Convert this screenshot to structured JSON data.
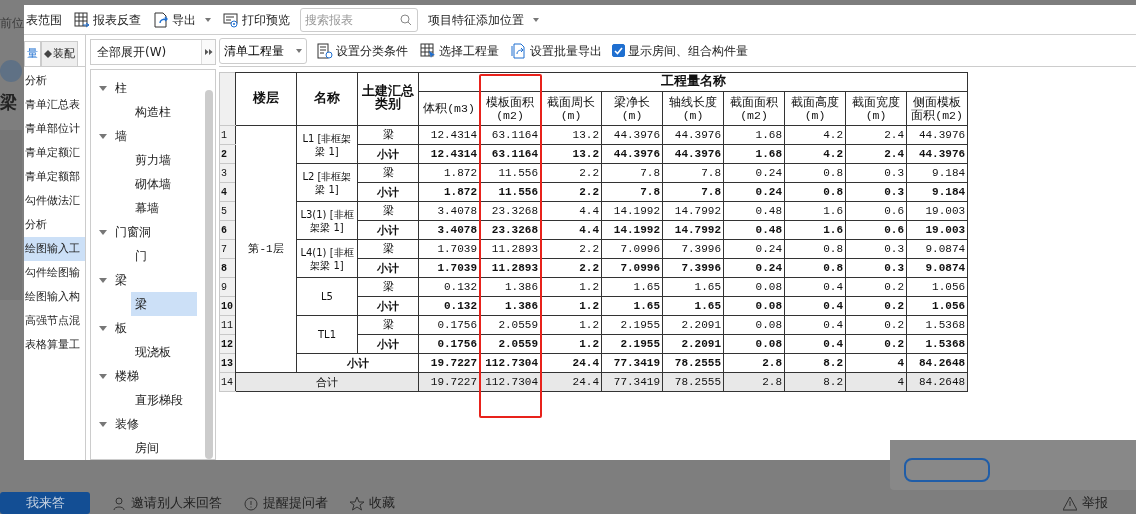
{
  "background_page": {
    "breadcrumb": "前位",
    "heading": "梁",
    "actions": [
      {
        "kind": "primary",
        "label": "我来答"
      },
      {
        "kind": "invite",
        "label": "邀请别人来回答"
      },
      {
        "kind": "remind",
        "label": "提醒提问者"
      },
      {
        "kind": "favorite",
        "label": "收藏"
      },
      {
        "kind": "report",
        "label": "举报"
      }
    ]
  },
  "toolbar": [
    {
      "kind": "text",
      "label": "表范围"
    },
    {
      "kind": "button",
      "label": "报表反查"
    },
    {
      "kind": "menu_button",
      "label": "导出"
    },
    {
      "kind": "button",
      "label": "打印预览"
    },
    {
      "kind": "search",
      "placeholder": "搜索报表"
    },
    {
      "kind": "dropdown",
      "label": "项目特征添加位置"
    }
  ],
  "left_tabs": [
    {
      "label": "量",
      "selected": true
    },
    {
      "label": "装配",
      "selected": false
    }
  ],
  "report_list": [
    {
      "label": "分析",
      "selected": false
    },
    {
      "label": "青单汇总表",
      "selected": false
    },
    {
      "label": "青单部位计",
      "selected": false
    },
    {
      "label": "青单定额汇",
      "selected": false
    },
    {
      "label": "青单定额部",
      "selected": false
    },
    {
      "label": "勾件做法汇",
      "selected": false
    },
    {
      "label": "分析",
      "selected": false
    },
    {
      "label": "绘图输入工",
      "selected": true
    },
    {
      "label": "勾件绘图输",
      "selected": false
    },
    {
      "label": "绘图输入构",
      "selected": false
    },
    {
      "label": "高强节点混",
      "selected": false
    },
    {
      "label": "表格算量工",
      "selected": false
    }
  ],
  "tree_filter": {
    "value": "全部展开(W)"
  },
  "tree": [
    {
      "label": "柱",
      "expanded": true,
      "children": [
        {
          "label": "构造柱",
          "selected": false
        }
      ]
    },
    {
      "label": "墙",
      "expanded": true,
      "children": [
        {
          "label": "剪力墙",
          "selected": false
        },
        {
          "label": "砌体墙",
          "selected": false
        },
        {
          "label": "幕墙",
          "selected": false
        }
      ]
    },
    {
      "label": "门窗洞",
      "expanded": true,
      "children": [
        {
          "label": "门",
          "selected": false
        }
      ]
    },
    {
      "label": "梁",
      "expanded": true,
      "children": [
        {
          "label": "梁",
          "selected": true
        }
      ]
    },
    {
      "label": "板",
      "expanded": true,
      "children": [
        {
          "label": "现浇板",
          "selected": false
        }
      ]
    },
    {
      "label": "楼梯",
      "expanded": true,
      "children": [
        {
          "label": "直形梯段",
          "selected": false
        }
      ]
    },
    {
      "label": "装修",
      "expanded": true,
      "children": [
        {
          "label": "房间",
          "selected": false
        }
      ]
    }
  ],
  "toolbar2": [
    {
      "kind": "dropdown",
      "label": "清单工程量"
    },
    {
      "kind": "button",
      "label": "设置分类条件"
    },
    {
      "kind": "button",
      "label": "选择工程量"
    },
    {
      "kind": "button",
      "label": "设置批量导出"
    },
    {
      "kind": "checkbox",
      "label": "显示房间、组合构件量",
      "checked": true
    }
  ],
  "table": {
    "group_header": "工程量名称",
    "columns": [
      {
        "label": "楼层",
        "highlighted": false
      },
      {
        "label": "名称",
        "highlighted": false
      },
      {
        "label": "土建汇总类别",
        "highlighted": false
      },
      {
        "label": "体积(m3)",
        "highlighted": false
      },
      {
        "label": "模板面积(m2)",
        "highlighted": true
      },
      {
        "label": "截面周长(m)",
        "highlighted": false
      },
      {
        "label": "梁净长(m)",
        "highlighted": false
      },
      {
        "label": "轴线长度(m)",
        "highlighted": false
      },
      {
        "label": "截面面积(m2)",
        "highlighted": false
      },
      {
        "label": "截面高度(m)",
        "highlighted": false
      },
      {
        "label": "截面宽度(m)",
        "highlighted": false
      },
      {
        "label": "侧面模板面积(m2)",
        "highlighted": false
      }
    ],
    "floors": [
      {
        "floor": "第-1层",
        "members": [
          {
            "name": "L1 [非框架梁 1]",
            "rows": [
              {
                "num": "1",
                "kind": "item",
                "category": "梁",
                "values": [
                  "12.4314",
                  "63.1164",
                  "13.2",
                  "44.3976",
                  "44.3976",
                  "1.68",
                  "4.2",
                  "2.4",
                  "44.3976"
                ]
              },
              {
                "num": "2",
                "kind": "subtotal",
                "category": "小计",
                "values": [
                  "12.4314",
                  "63.1164",
                  "13.2",
                  "44.3976",
                  "44.3976",
                  "1.68",
                  "4.2",
                  "2.4",
                  "44.3976"
                ]
              }
            ]
          },
          {
            "name": "L2 [非框架梁 1]",
            "rows": [
              {
                "num": "3",
                "kind": "item",
                "category": "梁",
                "values": [
                  "1.872",
                  "11.556",
                  "2.2",
                  "7.8",
                  "7.8",
                  "0.24",
                  "0.8",
                  "0.3",
                  "9.184"
                ]
              },
              {
                "num": "4",
                "kind": "subtotal",
                "category": "小计",
                "values": [
                  "1.872",
                  "11.556",
                  "2.2",
                  "7.8",
                  "7.8",
                  "0.24",
                  "0.8",
                  "0.3",
                  "9.184"
                ]
              }
            ]
          },
          {
            "name": "L3(1) [非框架梁 1]",
            "rows": [
              {
                "num": "5",
                "kind": "item",
                "category": "梁",
                "values": [
                  "3.4078",
                  "23.3268",
                  "4.4",
                  "14.1992",
                  "14.7992",
                  "0.48",
                  "1.6",
                  "0.6",
                  "19.003"
                ]
              },
              {
                "num": "6",
                "kind": "subtotal",
                "category": "小计",
                "values": [
                  "3.4078",
                  "23.3268",
                  "4.4",
                  "14.1992",
                  "14.7992",
                  "0.48",
                  "1.6",
                  "0.6",
                  "19.003"
                ]
              }
            ]
          },
          {
            "name": "L4(1) [非框架梁 1]",
            "rows": [
              {
                "num": "7",
                "kind": "item",
                "category": "梁",
                "values": [
                  "1.7039",
                  "11.2893",
                  "2.2",
                  "7.0996",
                  "7.3996",
                  "0.24",
                  "0.8",
                  "0.3",
                  "9.0874"
                ]
              },
              {
                "num": "8",
                "kind": "subtotal",
                "category": "小计",
                "values": [
                  "1.7039",
                  "11.2893",
                  "2.2",
                  "7.0996",
                  "7.3996",
                  "0.24",
                  "0.8",
                  "0.3",
                  "9.0874"
                ]
              }
            ]
          },
          {
            "name": "L5",
            "rows": [
              {
                "num": "9",
                "kind": "item",
                "category": "梁",
                "values": [
                  "0.132",
                  "1.386",
                  "1.2",
                  "1.65",
                  "1.65",
                  "0.08",
                  "0.4",
                  "0.2",
                  "1.056"
                ]
              },
              {
                "num": "10",
                "kind": "subtotal",
                "category": "小计",
                "values": [
                  "0.132",
                  "1.386",
                  "1.2",
                  "1.65",
                  "1.65",
                  "0.08",
                  "0.4",
                  "0.2",
                  "1.056"
                ]
              }
            ]
          },
          {
            "name": "TL1",
            "rows": [
              {
                "num": "11",
                "kind": "item",
                "category": "梁",
                "values": [
                  "0.1756",
                  "2.0559",
                  "1.2",
                  "2.1955",
                  "2.2091",
                  "0.08",
                  "0.4",
                  "0.2",
                  "1.5368"
                ]
              },
              {
                "num": "12",
                "kind": "subtotal",
                "category": "小计",
                "values": [
                  "0.1756",
                  "2.0559",
                  "1.2",
                  "2.1955",
                  "2.2091",
                  "0.08",
                  "0.4",
                  "0.2",
                  "1.5368"
                ]
              }
            ]
          }
        ],
        "subtotal": {
          "num": "13",
          "label": "小计",
          "values": [
            "19.7227",
            "112.7304",
            "24.4",
            "77.3419",
            "78.2555",
            "2.8",
            "8.2",
            "4",
            "84.2648"
          ]
        }
      }
    ],
    "total": {
      "num": "14",
      "label": "合计",
      "values": [
        "19.7227",
        "112.7304",
        "24.4",
        "77.3419",
        "78.2555",
        "2.8",
        "8.2",
        "4",
        "84.2648"
      ]
    }
  }
}
